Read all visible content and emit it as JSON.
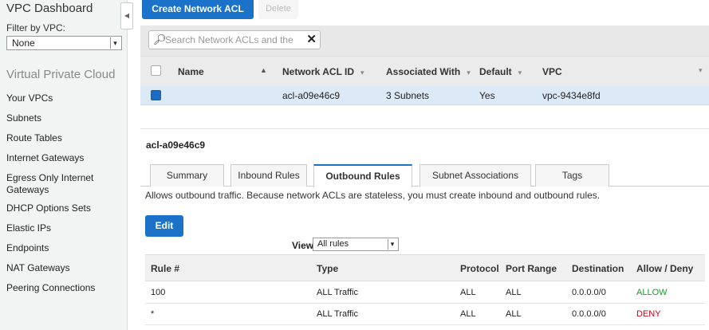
{
  "sidebar": {
    "title": "VPC Dashboard",
    "filter_label": "Filter by VPC:",
    "filter_value": "None",
    "section_title": "Virtual Private Cloud",
    "items": [
      "Your VPCs",
      "Subnets",
      "Route Tables",
      "Internet Gateways",
      "Egress Only Internet Gateways",
      "DHCP Options Sets",
      "Elastic IPs",
      "Endpoints",
      "NAT Gateways",
      "Peering Connections"
    ]
  },
  "toolbar": {
    "create_label": "Create Network ACL",
    "delete_label": "Delete"
  },
  "search": {
    "placeholder": "Search Network ACLs and the"
  },
  "table": {
    "columns": [
      "Name",
      "Network ACL ID",
      "Associated With",
      "Default",
      "VPC"
    ],
    "rows": [
      {
        "name": "",
        "acl_id": "acl-a09e46c9",
        "associated": "3 Subnets",
        "default": "Yes",
        "vpc": "vpc-9434e8fd"
      }
    ]
  },
  "detail": {
    "title": "acl-a09e46c9",
    "tabs": [
      "Summary",
      "Inbound Rules",
      "Outbound Rules",
      "Subnet Associations",
      "Tags"
    ],
    "active_tab": "Outbound Rules",
    "description": "Allows outbound traffic. Because network ACLs are stateless, you must create inbound and outbound rules.",
    "edit_label": "Edit",
    "view_label": "View:",
    "view_value": "All rules",
    "rule_columns": [
      "Rule #",
      "Type",
      "Protocol",
      "Port Range",
      "Destination",
      "Allow / Deny"
    ],
    "rules": [
      {
        "rule": "100",
        "type": "ALL Traffic",
        "protocol": "ALL",
        "port": "ALL",
        "destination": "0.0.0.0/0",
        "action": "ALLOW"
      },
      {
        "rule": "*",
        "type": "ALL Traffic",
        "protocol": "ALL",
        "port": "ALL",
        "destination": "0.0.0.0/0",
        "action": "DENY"
      }
    ]
  },
  "colors": {
    "primary": "#1a73c9",
    "allow": "#1d9a2b",
    "deny": "#d0021b",
    "selected_row": "#dce9f7"
  }
}
